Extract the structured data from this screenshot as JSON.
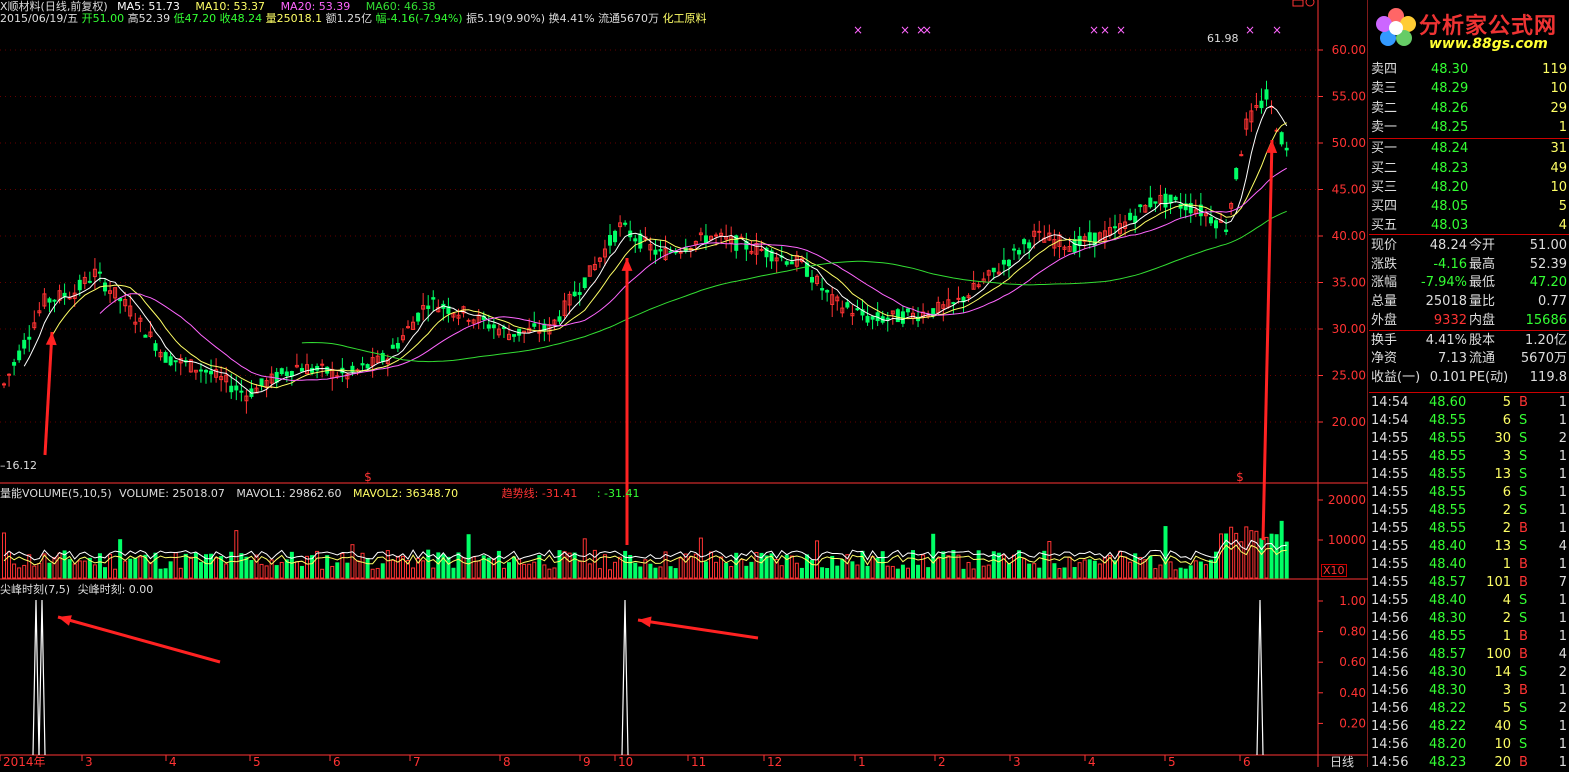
{
  "header": {
    "line1_name": "X顺材料(日线,前复权)",
    "ma5": "MA5: 51.73",
    "ma10": "MA10: 53.37",
    "ma20": "MA20: 53.39",
    "ma60": "MA60: 46.38",
    "line2_date": "2015/06/19/五",
    "line2_open": "开51.00",
    "line2_high": "高52.39",
    "line2_low": "低47.20",
    "line2_close": "收48.24",
    "line2_vol": "量25018.1",
    "line2_amt": "额1.25亿",
    "line2_chg": "幅-4.16(-7.94%)",
    "line2_amp": "振5.19(9.90%)",
    "line2_turn": "换4.41%",
    "line2_float": "流通5670万",
    "line2_sector": "化工原料"
  },
  "volume_header": {
    "name": "量能VOLUME(5,10,5)",
    "vol": "VOLUME: 25018.07",
    "mavol1": "MAVOL1: 29862.60",
    "mavol2": "MAVOL2: 36348.70",
    "trend": "趋势线: -31.41",
    "trend2": ": -31.41"
  },
  "indicator_header": {
    "name": "尖峰时刻(7,5)",
    "value": "尖峰时刻: 0.00"
  },
  "annotations": {
    "high": "61.98",
    "low": "16.12",
    "x10": "X10",
    "period": "日线"
  },
  "price_axis": [
    "60.00",
    "55.00",
    "50.00",
    "45.00",
    "40.00",
    "35.00",
    "30.00",
    "25.00",
    "20.00"
  ],
  "volume_axis": [
    "20000",
    "10000"
  ],
  "indicator_axis": [
    "1.00",
    "0.80",
    "0.60",
    "0.40",
    "0.20"
  ],
  "x_axis": [
    "2014年",
    "3",
    "4",
    "5",
    "6",
    "7",
    "8",
    "9",
    "10",
    "11",
    "12",
    "1",
    "2",
    "3",
    "4",
    "5",
    "6"
  ],
  "logo": {
    "title": "分析家公式网",
    "url": "www.88gs.com"
  },
  "order_book": [
    {
      "label": "卖四",
      "price": "48.30",
      "vol": "119"
    },
    {
      "label": "卖三",
      "price": "48.29",
      "vol": "10"
    },
    {
      "label": "卖二",
      "price": "48.26",
      "vol": "29"
    },
    {
      "label": "卖一",
      "price": "48.25",
      "vol": "1"
    },
    {
      "label": "买一",
      "price": "48.24",
      "vol": "31"
    },
    {
      "label": "买二",
      "price": "48.23",
      "vol": "49"
    },
    {
      "label": "买三",
      "price": "48.20",
      "vol": "10"
    },
    {
      "label": "买四",
      "price": "48.05",
      "vol": "5"
    },
    {
      "label": "买五",
      "price": "48.03",
      "vol": "4"
    }
  ],
  "stats": [
    {
      "l1": "现价",
      "v1": "48.24",
      "l2": "今开",
      "v2": "51.00"
    },
    {
      "l1": "涨跌",
      "v1": "-4.16",
      "l2": "最高",
      "v2": "52.39"
    },
    {
      "l1": "涨幅",
      "v1": "-7.94%",
      "l2": "最低",
      "v2": "47.20"
    },
    {
      "l1": "总量",
      "v1": "25018",
      "l2": "量比",
      "v2": "0.77"
    },
    {
      "l1": "外盘",
      "v1": "9332",
      "l2": "内盘",
      "v2": "15686"
    },
    {
      "l1": "换手",
      "v1": "4.41%",
      "l2": "股本",
      "v2": "1.20亿"
    },
    {
      "l1": "净资",
      "v1": "7.13",
      "l2": "流通",
      "v2": "5670万"
    },
    {
      "l1": "收益(一)",
      "v1": "0.101",
      "l2": "PE(动)",
      "v2": "119.8"
    }
  ],
  "ticks": [
    {
      "t": "14:54",
      "p": "48.60",
      "v": "5",
      "s": "B",
      "n": "1"
    },
    {
      "t": "14:54",
      "p": "48.55",
      "v": "6",
      "s": "S",
      "n": "1"
    },
    {
      "t": "14:55",
      "p": "48.55",
      "v": "30",
      "s": "S",
      "n": "2"
    },
    {
      "t": "14:55",
      "p": "48.55",
      "v": "3",
      "s": "S",
      "n": "1"
    },
    {
      "t": "14:55",
      "p": "48.55",
      "v": "13",
      "s": "S",
      "n": "1"
    },
    {
      "t": "14:55",
      "p": "48.55",
      "v": "6",
      "s": "S",
      "n": "1"
    },
    {
      "t": "14:55",
      "p": "48.55",
      "v": "2",
      "s": "S",
      "n": "1"
    },
    {
      "t": "14:55",
      "p": "48.55",
      "v": "2",
      "s": "B",
      "n": "1"
    },
    {
      "t": "14:55",
      "p": "48.40",
      "v": "13",
      "s": "S",
      "n": "4"
    },
    {
      "t": "14:55",
      "p": "48.40",
      "v": "1",
      "s": "B",
      "n": "1"
    },
    {
      "t": "14:55",
      "p": "48.57",
      "v": "101",
      "s": "B",
      "n": "7"
    },
    {
      "t": "14:55",
      "p": "48.40",
      "v": "4",
      "s": "S",
      "n": "1"
    },
    {
      "t": "14:56",
      "p": "48.30",
      "v": "2",
      "s": "S",
      "n": "1"
    },
    {
      "t": "14:56",
      "p": "48.55",
      "v": "1",
      "s": "B",
      "n": "1"
    },
    {
      "t": "14:56",
      "p": "48.57",
      "v": "100",
      "s": "B",
      "n": "4"
    },
    {
      "t": "14:56",
      "p": "48.30",
      "v": "14",
      "s": "S",
      "n": "2"
    },
    {
      "t": "14:56",
      "p": "48.30",
      "v": "3",
      "s": "B",
      "n": "1"
    },
    {
      "t": "14:56",
      "p": "48.22",
      "v": "5",
      "s": "S",
      "n": "2"
    },
    {
      "t": "14:56",
      "p": "48.22",
      "v": "40",
      "s": "S",
      "n": "1"
    },
    {
      "t": "14:56",
      "p": "48.20",
      "v": "10",
      "s": "S",
      "n": "1"
    },
    {
      "t": "14:56",
      "p": "48.23",
      "v": "20",
      "s": "B",
      "n": "1"
    }
  ],
  "colors": {
    "up": "#ff3333",
    "down": "#00ff66",
    "axis": "#ff3333",
    "ma5": "#ffffff",
    "ma10": "#ffff66",
    "ma20": "#ff66ff",
    "ma60": "#33dd33",
    "arrow": "#ff2222"
  }
}
